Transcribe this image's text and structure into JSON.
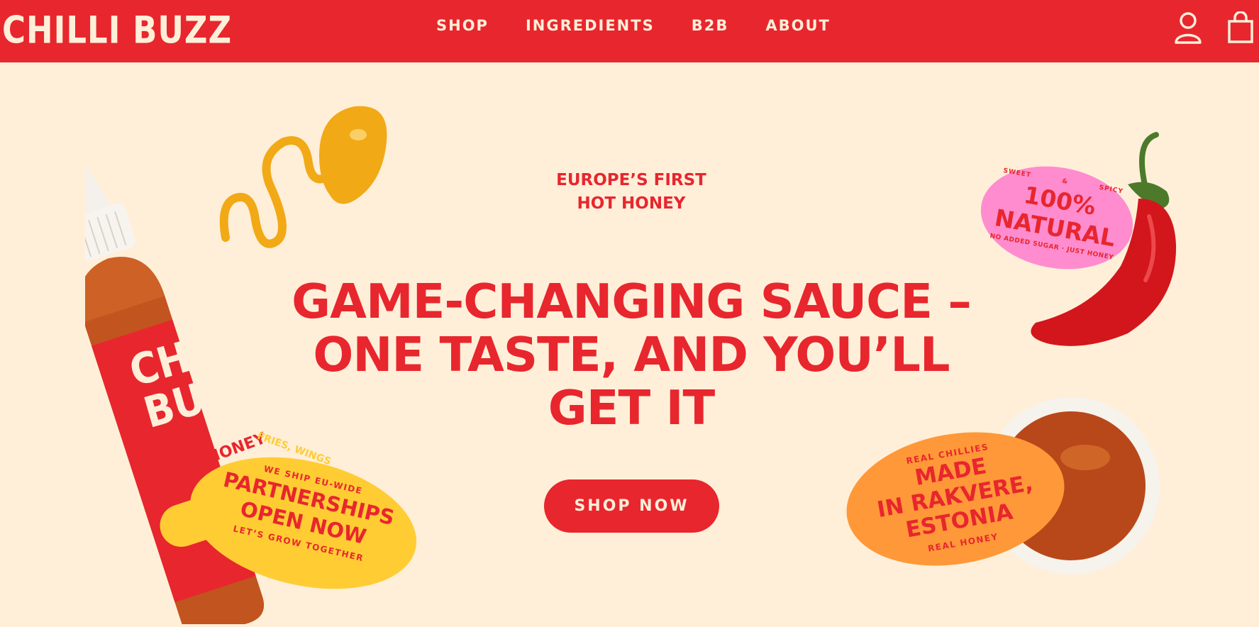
{
  "header": {
    "logo": "CHILLI BUZZ",
    "nav": [
      "SHOP",
      "INGREDIENTS",
      "B2B",
      "ABOUT"
    ],
    "account_icon": "user-icon",
    "cart_icon": "shopping-bag-icon"
  },
  "hero": {
    "eyebrow_line1": "EUROPE’S FIRST",
    "eyebrow_line2": "HOT HONEY",
    "headline_line1": "GAME-CHANGING SAUCE –",
    "headline_line2": "ONE TASTE, AND YOU’LL",
    "headline_line3": "GET IT",
    "cta": "SHOP NOW"
  },
  "bottle": {
    "brand_line1": "CHILLI",
    "brand_line2": "BUZZ",
    "label": "HOT HONEY",
    "side_text": "FRIES, WINGS"
  },
  "badges": {
    "natural": {
      "top_left": "SWEET",
      "top_mid": "&",
      "top_right": "SPICY",
      "line1": "100%",
      "line2": "NATURAL",
      "bottom": "NO ADDED SUGAR · JUST HONEY"
    },
    "partners": {
      "top": "WE SHIP EU-WIDE",
      "line1": "PARTNERSHIPS",
      "line2": "OPEN NOW",
      "bottom": "LET’S GROW TOGETHER"
    },
    "made": {
      "top": "REAL CHILLIES",
      "line1": "MADE",
      "line2": "IN RAKVERE,",
      "line3": "ESTONIA",
      "bottom": "REAL HONEY"
    }
  },
  "colors": {
    "brand_red": "#e8262e",
    "cream": "#ffefd9",
    "pink": "#ff8ccf",
    "yellow": "#ffcc33",
    "orange": "#ff9838"
  }
}
